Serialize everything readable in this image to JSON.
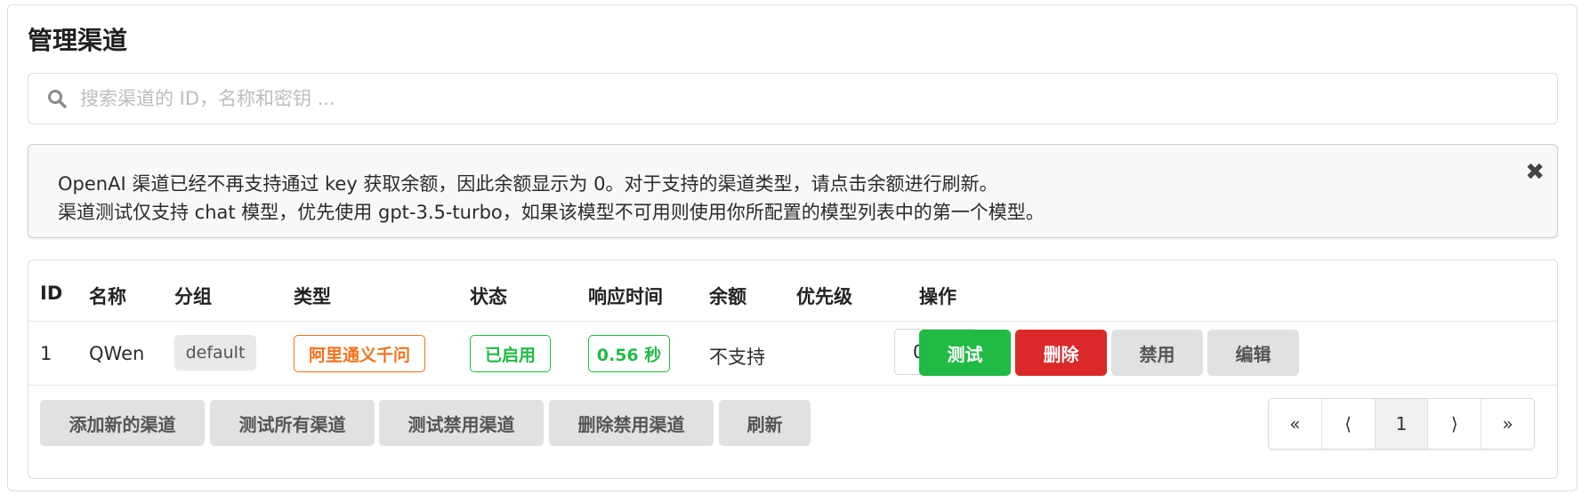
{
  "page": {
    "title": "管理渠道"
  },
  "search": {
    "placeholder": "搜索渠道的 ID，名称和密钥 ...",
    "value": "",
    "icon": "search-icon"
  },
  "notice": {
    "line1": "OpenAI 渠道已经不再支持通过 key 获取余额，因此余额显示为 0。对于支持的渠道类型，请点击余额进行刷新。",
    "line2": "渠道测试仅支持 chat 模型，优先使用 gpt-3.5-turbo，如果该模型不可用则使用你所配置的模型列表中的第一个模型。",
    "close_icon": "close-icon"
  },
  "table": {
    "columns": [
      "ID",
      "名称",
      "分组",
      "类型",
      "状态",
      "响应时间",
      "余额",
      "优先级",
      "操作"
    ],
    "rows": [
      {
        "id": "1",
        "name": "QWen",
        "group": "default",
        "type": "阿里通义千问",
        "status": "已启用",
        "response_time": "0.56 秒",
        "balance": "不支持",
        "priority": "0",
        "actions": [
          "测试",
          "删除",
          "禁用",
          "编辑"
        ]
      }
    ]
  },
  "footer": {
    "buttons": [
      "添加新的渠道",
      "测试所有渠道",
      "测试禁用渠道",
      "删除禁用渠道",
      "刷新"
    ]
  },
  "pagination": {
    "first": "«",
    "prev": "⟨",
    "current": "1",
    "next": "⟩",
    "last": "»"
  },
  "colors": {
    "type_tag": "#f2711c",
    "status_tag": "#21ba45",
    "test_button": "#21ba45",
    "delete_button": "#db2828"
  }
}
